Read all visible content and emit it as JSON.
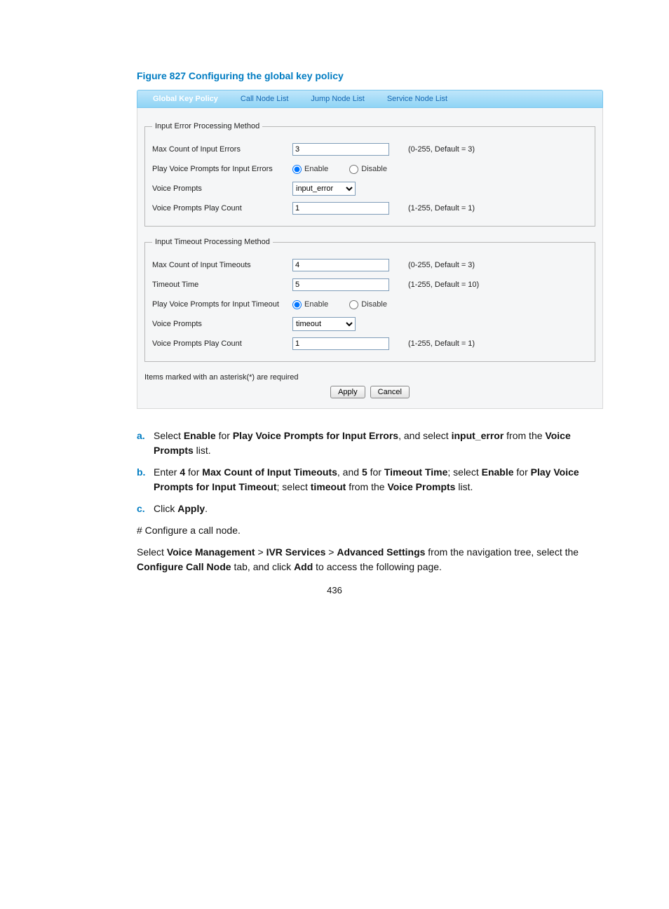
{
  "figure_title": "Figure 827 Configuring the global key policy",
  "tabs": {
    "global_key_policy": "Global Key Policy",
    "call_node_list": "Call Node List",
    "jump_node_list": "Jump Node List",
    "service_node_list": "Service Node List"
  },
  "fieldset1": {
    "legend": "Input Error Processing Method",
    "row1_label": "Max Count of Input Errors",
    "row1_value": "3",
    "row1_hint": "(0-255, Default = 3)",
    "row2_label": "Play Voice Prompts for Input Errors",
    "enable": "Enable",
    "disable": "Disable",
    "row3_label": "Voice Prompts",
    "row3_select": "input_error",
    "row4_label": "Voice Prompts Play Count",
    "row4_value": "1",
    "row4_hint": "(1-255, Default = 1)"
  },
  "fieldset2": {
    "legend": "Input Timeout Processing Method",
    "row1_label": "Max Count of Input Timeouts",
    "row1_value": "4",
    "row1_hint": "(0-255, Default = 3)",
    "row2_label": "Timeout Time",
    "row2_value": "5",
    "row2_hint": "(1-255, Default = 10)",
    "row3_label": "Play Voice Prompts for Input Timeout",
    "enable": "Enable",
    "disable": "Disable",
    "row4_label": "Voice Prompts",
    "row4_select": "timeout",
    "row5_label": "Voice Prompts Play Count",
    "row5_value": "1",
    "row5_hint": "(1-255, Default = 1)"
  },
  "footer_note": "Items marked with an asterisk(*) are required",
  "buttons": {
    "apply": "Apply",
    "cancel": "Cancel"
  },
  "instr": {
    "a_letter": "a.",
    "a_text_1": "Select ",
    "a_text_2": "Enable",
    "a_text_3": " for ",
    "a_text_4": "Play Voice Prompts for Input Errors",
    "a_text_5": ", and select ",
    "a_text_6": "input_error",
    "a_text_7": " from the ",
    "a_text_8": "Voice Prompts",
    "a_text_9": " list.",
    "b_letter": "b.",
    "b_text_1": "Enter ",
    "b_text_2": "4",
    "b_text_3": " for ",
    "b_text_4": "Max Count of Input Timeouts",
    "b_text_5": ", and ",
    "b_text_6": "5",
    "b_text_7": " for ",
    "b_text_8": "Timeout Time",
    "b_text_9": "; select ",
    "b_text_10": "Enable",
    "b_text_11": " for ",
    "b_text_12": "Play Voice Prompts for Input Timeout",
    "b_text_13": "; select ",
    "b_text_14": "timeout",
    "b_text_15": " from the ",
    "b_text_16": "Voice Prompts",
    "b_text_17": " list.",
    "c_letter": "c.",
    "c_text_1": "Click ",
    "c_text_2": "Apply",
    "c_text_3": "."
  },
  "para1": "# Configure a call node.",
  "para2_1": "Select ",
  "para2_2": "Voice Management",
  "para2_3": " > ",
  "para2_4": "IVR Services",
  "para2_5": " > ",
  "para2_6": "Advanced Settings",
  "para2_7": " from the navigation tree, select the ",
  "para2_8": "Configure Call Node",
  "para2_9": " tab, and click ",
  "para2_10": "Add",
  "para2_11": " to access the following page.",
  "page_number": "436"
}
